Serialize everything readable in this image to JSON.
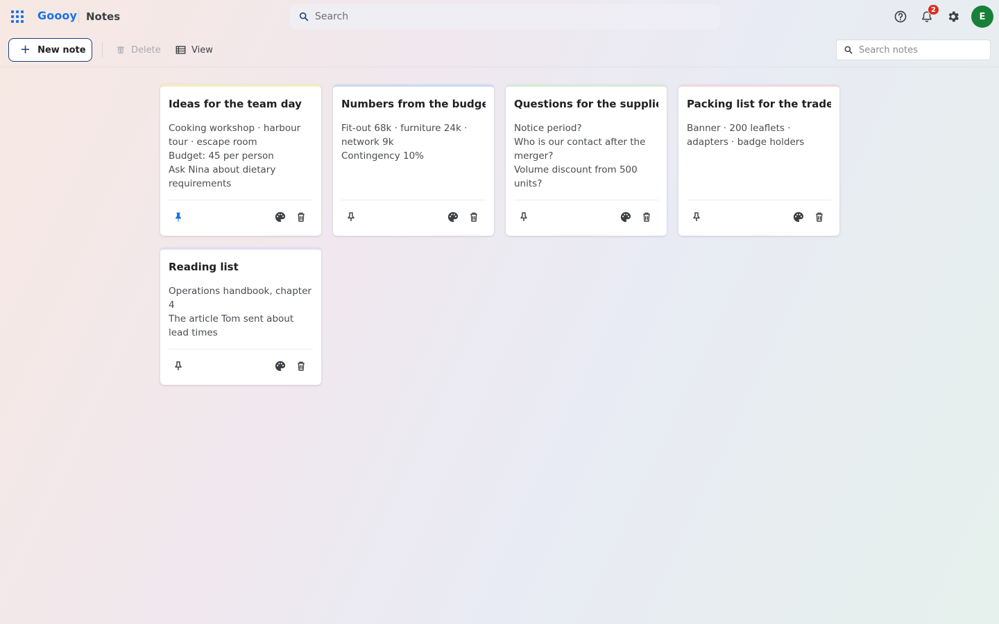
{
  "header": {
    "brand": "Goooy",
    "app_name": "Notes",
    "search_placeholder": "Search",
    "notification_count": "2",
    "avatar_initial": "E",
    "avatar_color": "#188038",
    "accent_color": "#1a73e8",
    "icons": [
      "apps-grid-icon",
      "search-icon",
      "help-icon",
      "bell-icon",
      "gear-icon"
    ]
  },
  "toolbar": {
    "new_note_label": "New note",
    "delete_label": "Delete",
    "view_label": "View",
    "search_placeholder": "Search notes"
  },
  "notes": [
    {
      "title": "Ideas for the team day",
      "lines": [
        "Cooking workshop · harbour tour · escape room",
        "Budget: 45 per person",
        "Ask Nina about dietary requirements"
      ],
      "pinned": true,
      "accent": "#f2efbd"
    },
    {
      "title": "Numbers from the budget c",
      "lines": [
        "Fit-out 68k · furniture 24k · network 9k",
        "Contingency 10%"
      ],
      "pinned": false,
      "accent": "#c9dbf2"
    },
    {
      "title": "Questions for the supplier",
      "lines": [
        "Notice period?",
        "Who is our contact after the merger?",
        "Volume discount from 500 units?"
      ],
      "pinned": false,
      "accent": "#d4ecd4"
    },
    {
      "title": "Packing list for the trade fai",
      "lines": [
        "Banner · 200 leaflets · adapters · badge holders"
      ],
      "pinned": false,
      "accent": "#f4d6dc"
    },
    {
      "title": "Reading list",
      "lines": [
        "Operations handbook, chapter 4",
        "The article Tom sent about lead times"
      ],
      "pinned": false,
      "accent": "#e2dcf2"
    }
  ]
}
